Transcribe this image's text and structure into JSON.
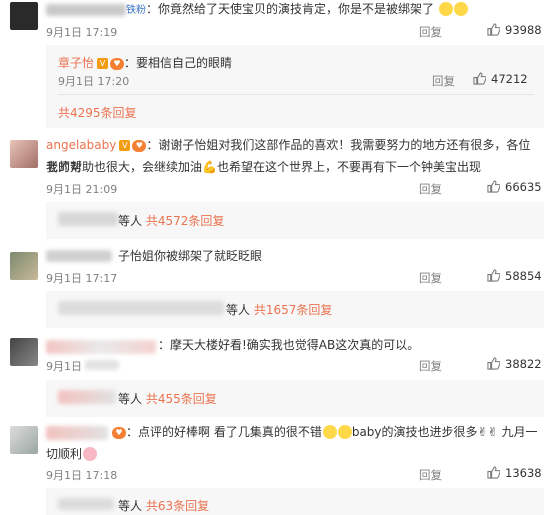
{
  "c1": {
    "text": "：你竟然给了天使宝贝的演技肯定，你是不是被绑架了",
    "time": "9月1日 17:19",
    "reply": "回复",
    "likes": "93988",
    "fan_tag": "铁粉"
  },
  "c1r": {
    "user": "章子怡",
    "text": "：要相信自己的眼睛",
    "time": "9月1日 17:20",
    "reply": "回复",
    "likes": "47212",
    "more": "共4295条回复"
  },
  "c2": {
    "user": "angelababy",
    "text1": "：谢谢子怡姐对我们这部作品的喜欢！我需要努力的地方还有很多，各位老师对",
    "text2": "我的帮助也很大，会继续加油",
    "text3": "也希望在这个世界上，不要再有下一个钟美宝出现",
    "time": "9月1日 21:09",
    "reply": "回复",
    "likes": "66635",
    "more_prefix": "等人",
    "more": "共4572条回复"
  },
  "c3": {
    "text": "子怡姐你被绑架了就眨眨眼",
    "time": "9月1日 17:17",
    "reply": "回复",
    "likes": "58854",
    "more_prefix": "等人",
    "more": "共1657条回复"
  },
  "c4": {
    "text": "：摩天大楼好看!确实我也觉得AB这次真的可以。",
    "time": "9月1日",
    "reply": "回复",
    "likes": "38822",
    "more_prefix": "等人",
    "more": "共455条回复"
  },
  "c5": {
    "text1": "：点评的好棒啊 看了几集真的很不错",
    "text2": "baby的演技也进步很多",
    "text3": "九月一",
    "text4": "切顺利",
    "time": "9月1日 17:18",
    "reply": "回复",
    "likes": "13638",
    "more_prefix": "等人",
    "more": "共63条回复"
  },
  "colors": {
    "accent": "#eb7350",
    "subbg": "#f7f7f7"
  }
}
